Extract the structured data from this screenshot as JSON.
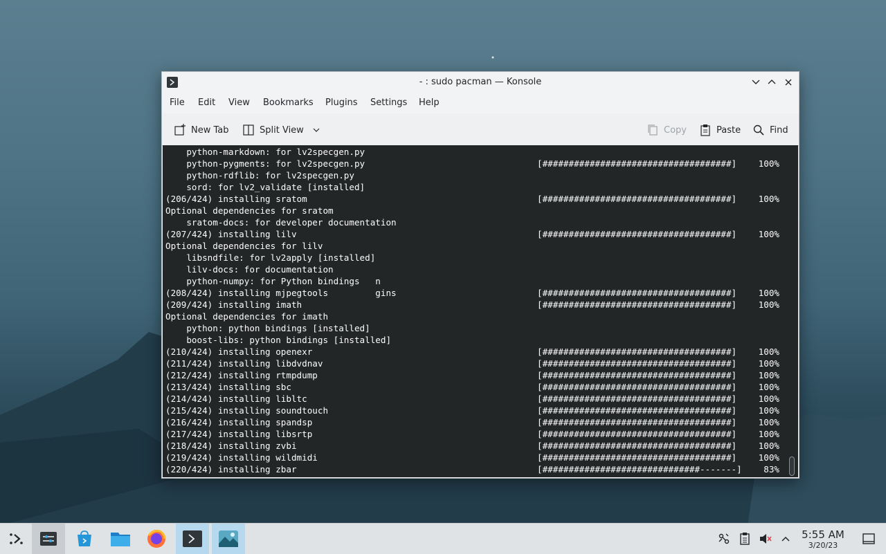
{
  "window": {
    "title": "- : sudo pacman — Konsole",
    "icon": "terminal-icon"
  },
  "menu": [
    "File",
    "Edit",
    "View",
    "Bookmarks",
    "Plugins",
    "Settings",
    "Help"
  ],
  "toolbar": {
    "new_tab": "New Tab",
    "split_view": "Split View",
    "copy": "Copy",
    "paste": "Paste",
    "find": "Find"
  },
  "terminal": {
    "lines": [
      {
        "text": "    python-markdown: for lv2specgen.py",
        "bar": "",
        "pct": ""
      },
      {
        "text": "    python-pygments: for lv2specgen.py",
        "bar": "[####################################]",
        "pct": "100%"
      },
      {
        "text": "    python-rdflib: for lv2specgen.py",
        "bar": "",
        "pct": ""
      },
      {
        "text": "    sord: for lv2_validate [installed]",
        "bar": "",
        "pct": ""
      },
      {
        "text": "(206/424) installing sratom",
        "bar": "[####################################]",
        "pct": "100%"
      },
      {
        "text": "Optional dependencies for sratom",
        "bar": "",
        "pct": ""
      },
      {
        "text": "    sratom-docs: for developer documentation",
        "bar": "",
        "pct": ""
      },
      {
        "text": "(207/424) installing lilv",
        "bar": "[####################################]",
        "pct": "100%"
      },
      {
        "text": "Optional dependencies for lilv",
        "bar": "",
        "pct": ""
      },
      {
        "text": "    libsndfile: for lv2apply [installed]",
        "bar": "",
        "pct": ""
      },
      {
        "text": "    lilv-docs: for documentation",
        "bar": "",
        "pct": ""
      },
      {
        "text": "    python-numpy: for Python bindings   n",
        "bar": "",
        "pct": ""
      },
      {
        "text": "(208/424) installing mjpegtools         gins",
        "bar": "[####################################]",
        "pct": "100%"
      },
      {
        "text": "(209/424) installing imath",
        "bar": "[####################################]",
        "pct": "100%"
      },
      {
        "text": "Optional dependencies for imath",
        "bar": "",
        "pct": ""
      },
      {
        "text": "    python: python bindings [installed]",
        "bar": "",
        "pct": ""
      },
      {
        "text": "    boost-libs: python bindings [installed]",
        "bar": "",
        "pct": ""
      },
      {
        "text": "(210/424) installing openexr",
        "bar": "[####################################]",
        "pct": "100%"
      },
      {
        "text": "(211/424) installing libdvdnav",
        "bar": "[####################################]",
        "pct": "100%"
      },
      {
        "text": "(212/424) installing rtmpdump",
        "bar": "[####################################]",
        "pct": "100%"
      },
      {
        "text": "(213/424) installing sbc",
        "bar": "[####################################]",
        "pct": "100%"
      },
      {
        "text": "(214/424) installing libltc",
        "bar": "[####################################]",
        "pct": "100%"
      },
      {
        "text": "(215/424) installing soundtouch",
        "bar": "[####################################]",
        "pct": "100%"
      },
      {
        "text": "(216/424) installing spandsp",
        "bar": "[####################################]",
        "pct": "100%"
      },
      {
        "text": "(217/424) installing libsrtp",
        "bar": "[####################################]",
        "pct": "100%"
      },
      {
        "text": "(218/424) installing zvbi",
        "bar": "[####################################]",
        "pct": "100%"
      },
      {
        "text": "(219/424) installing wildmidi",
        "bar": "[####################################]",
        "pct": "100%"
      },
      {
        "text": "(220/424) installing zbar",
        "bar": "[##############################-------]",
        "pct": "83%"
      }
    ]
  },
  "taskbar": {
    "apps": [
      {
        "name": "application-launcher-icon",
        "active": false
      },
      {
        "name": "system-settings-icon",
        "active": false,
        "hover": true
      },
      {
        "name": "discover-store-icon",
        "active": false
      },
      {
        "name": "dolphin-files-icon",
        "active": false
      },
      {
        "name": "firefox-icon",
        "active": false
      },
      {
        "name": "konsole-icon",
        "active": true
      },
      {
        "name": "image-viewer-icon",
        "active": true
      }
    ],
    "clock_time": "5:55 AM",
    "clock_date": "3/20/23"
  },
  "colors": {
    "terminal_bg": "#232627",
    "terminal_fg": "#fcfcfc",
    "active_task": "#b6d9ef"
  }
}
